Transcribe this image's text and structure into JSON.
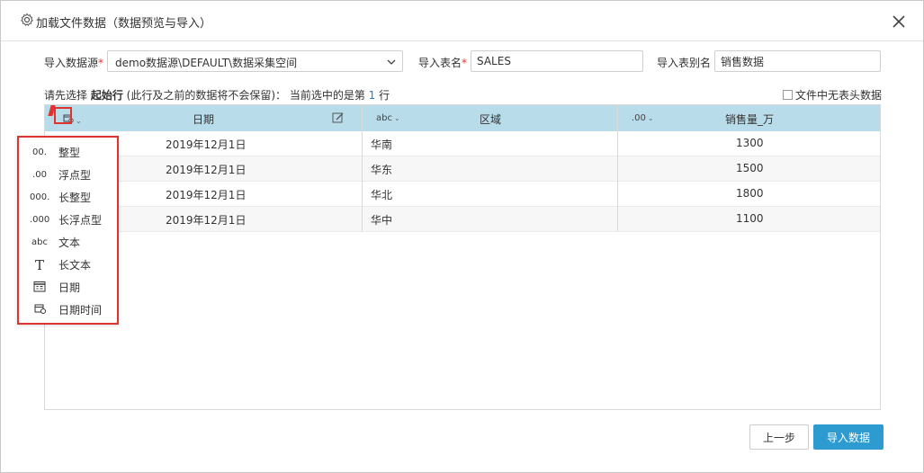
{
  "dialog": {
    "title": "加载文件数据（数据预览与导入）"
  },
  "form": {
    "datasource_label": "导入数据源",
    "datasource_value": "demo数据源\\DEFAULT\\数据采集空间",
    "table_name_label": "导入表名",
    "table_name_value": "SALES",
    "table_alias_label": "导入表别名",
    "table_alias_value": "销售数据",
    "required_mark": "*"
  },
  "hint": {
    "prefix": "请先选择 ",
    "bold": "起始行",
    "middle": " (此行及之前的数据将不会保留)： 当前选中的是第 ",
    "row_number": "1",
    "suffix": " 行"
  },
  "no_header_label": "文件中无表头数据",
  "grid": {
    "columns": [
      {
        "type_tag": "",
        "header": "日期"
      },
      {
        "type_tag": "abc",
        "header": "区域"
      },
      {
        "type_tag": ".00",
        "header": "销售量_万"
      }
    ],
    "rows": [
      [
        "2019年12月1日",
        "华南",
        "1300"
      ],
      [
        "2019年12月1日",
        "华东",
        "1500"
      ],
      [
        "2019年12月1日",
        "华北",
        "1800"
      ],
      [
        "2019年12月1日",
        "华中",
        "1100"
      ]
    ]
  },
  "type_menu": {
    "items": [
      {
        "icon": "00.",
        "label": "整型"
      },
      {
        "icon": ".00",
        "label": "浮点型"
      },
      {
        "icon": "000.",
        "label": "长整型"
      },
      {
        "icon": ".000",
        "label": "长浮点型"
      },
      {
        "icon": "abc",
        "label": "文本"
      },
      {
        "icon": "T",
        "label": "长文本"
      },
      {
        "icon": "",
        "label": "日期"
      },
      {
        "icon": "",
        "label": "日期时间"
      }
    ]
  },
  "buttons": {
    "prev": "上一步",
    "import": "导入数据"
  },
  "colors": {
    "header_bg": "#b8dcea",
    "primary": "#2e9bd0",
    "highlight": "#e0332f"
  }
}
